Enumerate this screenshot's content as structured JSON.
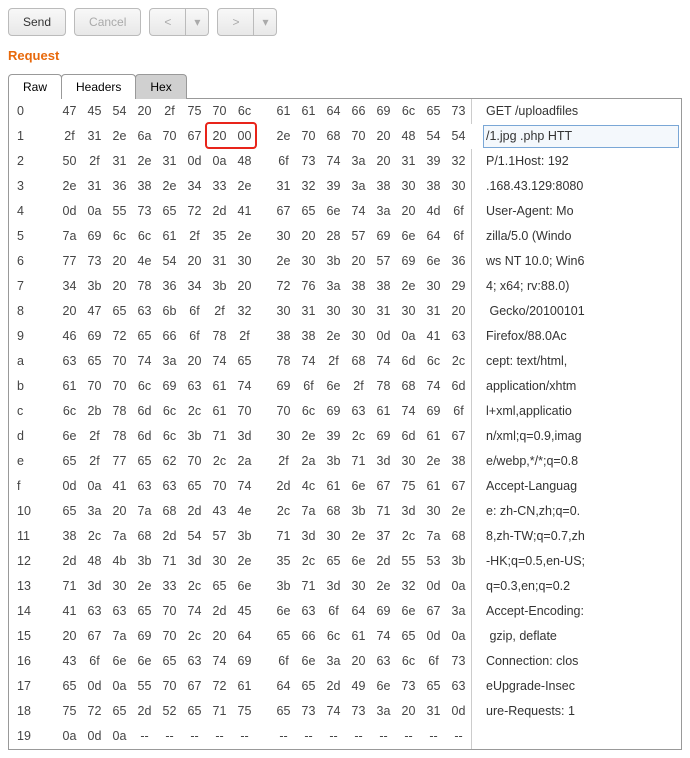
{
  "toolbar": {
    "send": "Send",
    "cancel": "Cancel",
    "back": "<",
    "forward": ">",
    "dropdown": "▾"
  },
  "section_title": "Request",
  "tabs": [
    "Raw",
    "Headers",
    "Hex"
  ],
  "active_tab": 2,
  "rows": [
    {
      "offset": "0",
      "bytes": [
        "47",
        "45",
        "54",
        "20",
        "2f",
        "75",
        "70",
        "6c",
        "61",
        "61",
        "64",
        "66",
        "69",
        "6c",
        "65",
        "73"
      ],
      "ascii": "GET /uploadfiles"
    },
    {
      "offset": "1",
      "bytes": [
        "2f",
        "31",
        "2e",
        "6a",
        "70",
        "67",
        "20",
        "00",
        "2e",
        "70",
        "68",
        "70",
        "20",
        "48",
        "54",
        "54"
      ],
      "ascii": "/1.jpg .php HTT",
      "highlighted": true
    },
    {
      "offset": "2",
      "bytes": [
        "50",
        "2f",
        "31",
        "2e",
        "31",
        "0d",
        "0a",
        "48",
        "6f",
        "73",
        "74",
        "3a",
        "20",
        "31",
        "39",
        "32"
      ],
      "ascii": "P/1.1Host: 192"
    },
    {
      "offset": "3",
      "bytes": [
        "2e",
        "31",
        "36",
        "38",
        "2e",
        "34",
        "33",
        "2e",
        "31",
        "32",
        "39",
        "3a",
        "38",
        "30",
        "38",
        "30"
      ],
      "ascii": ".168.43.129:8080"
    },
    {
      "offset": "4",
      "bytes": [
        "0d",
        "0a",
        "55",
        "73",
        "65",
        "72",
        "2d",
        "41",
        "67",
        "65",
        "6e",
        "74",
        "3a",
        "20",
        "4d",
        "6f"
      ],
      "ascii": "User-Agent: Mo"
    },
    {
      "offset": "5",
      "bytes": [
        "7a",
        "69",
        "6c",
        "6c",
        "61",
        "2f",
        "35",
        "2e",
        "30",
        "20",
        "28",
        "57",
        "69",
        "6e",
        "64",
        "6f"
      ],
      "ascii": "zilla/5.0 (Windo"
    },
    {
      "offset": "6",
      "bytes": [
        "77",
        "73",
        "20",
        "4e",
        "54",
        "20",
        "31",
        "30",
        "2e",
        "30",
        "3b",
        "20",
        "57",
        "69",
        "6e",
        "36"
      ],
      "ascii": "ws NT 10.0; Win6"
    },
    {
      "offset": "7",
      "bytes": [
        "34",
        "3b",
        "20",
        "78",
        "36",
        "34",
        "3b",
        "20",
        "72",
        "76",
        "3a",
        "38",
        "38",
        "2e",
        "30",
        "29"
      ],
      "ascii": "4; x64; rv:88.0)"
    },
    {
      "offset": "8",
      "bytes": [
        "20",
        "47",
        "65",
        "63",
        "6b",
        "6f",
        "2f",
        "32",
        "30",
        "31",
        "30",
        "30",
        "31",
        "30",
        "31",
        "20"
      ],
      "ascii": " Gecko/20100101"
    },
    {
      "offset": "9",
      "bytes": [
        "46",
        "69",
        "72",
        "65",
        "66",
        "6f",
        "78",
        "2f",
        "38",
        "38",
        "2e",
        "30",
        "0d",
        "0a",
        "41",
        "63"
      ],
      "ascii": "Firefox/88.0Ac"
    },
    {
      "offset": "a",
      "bytes": [
        "63",
        "65",
        "70",
        "74",
        "3a",
        "20",
        "74",
        "65",
        "78",
        "74",
        "2f",
        "68",
        "74",
        "6d",
        "6c",
        "2c"
      ],
      "ascii": "cept: text/html,"
    },
    {
      "offset": "b",
      "bytes": [
        "61",
        "70",
        "70",
        "6c",
        "69",
        "63",
        "61",
        "74",
        "69",
        "6f",
        "6e",
        "2f",
        "78",
        "68",
        "74",
        "6d"
      ],
      "ascii": "application/xhtm"
    },
    {
      "offset": "c",
      "bytes": [
        "6c",
        "2b",
        "78",
        "6d",
        "6c",
        "2c",
        "61",
        "70",
        "70",
        "6c",
        "69",
        "63",
        "61",
        "74",
        "69",
        "6f"
      ],
      "ascii": "l+xml,applicatio"
    },
    {
      "offset": "d",
      "bytes": [
        "6e",
        "2f",
        "78",
        "6d",
        "6c",
        "3b",
        "71",
        "3d",
        "30",
        "2e",
        "39",
        "2c",
        "69",
        "6d",
        "61",
        "67"
      ],
      "ascii": "n/xml;q=0.9,imag"
    },
    {
      "offset": "e",
      "bytes": [
        "65",
        "2f",
        "77",
        "65",
        "62",
        "70",
        "2c",
        "2a",
        "2f",
        "2a",
        "3b",
        "71",
        "3d",
        "30",
        "2e",
        "38"
      ],
      "ascii": "e/webp,*/*;q=0.8"
    },
    {
      "offset": "f",
      "bytes": [
        "0d",
        "0a",
        "41",
        "63",
        "63",
        "65",
        "70",
        "74",
        "2d",
        "4c",
        "61",
        "6e",
        "67",
        "75",
        "61",
        "67"
      ],
      "ascii": "Accept-Languag"
    },
    {
      "offset": "10",
      "bytes": [
        "65",
        "3a",
        "20",
        "7a",
        "68",
        "2d",
        "43",
        "4e",
        "2c",
        "7a",
        "68",
        "3b",
        "71",
        "3d",
        "30",
        "2e"
      ],
      "ascii": "e: zh-CN,zh;q=0."
    },
    {
      "offset": "11",
      "bytes": [
        "38",
        "2c",
        "7a",
        "68",
        "2d",
        "54",
        "57",
        "3b",
        "71",
        "3d",
        "30",
        "2e",
        "37",
        "2c",
        "7a",
        "68"
      ],
      "ascii": "8,zh-TW;q=0.7,zh"
    },
    {
      "offset": "12",
      "bytes": [
        "2d",
        "48",
        "4b",
        "3b",
        "71",
        "3d",
        "30",
        "2e",
        "35",
        "2c",
        "65",
        "6e",
        "2d",
        "55",
        "53",
        "3b"
      ],
      "ascii": "-HK;q=0.5,en-US;"
    },
    {
      "offset": "13",
      "bytes": [
        "71",
        "3d",
        "30",
        "2e",
        "33",
        "2c",
        "65",
        "6e",
        "3b",
        "71",
        "3d",
        "30",
        "2e",
        "32",
        "0d",
        "0a"
      ],
      "ascii": "q=0.3,en;q=0.2"
    },
    {
      "offset": "14",
      "bytes": [
        "41",
        "63",
        "63",
        "65",
        "70",
        "74",
        "2d",
        "45",
        "6e",
        "63",
        "6f",
        "64",
        "69",
        "6e",
        "67",
        "3a"
      ],
      "ascii": "Accept-Encoding:"
    },
    {
      "offset": "15",
      "bytes": [
        "20",
        "67",
        "7a",
        "69",
        "70",
        "2c",
        "20",
        "64",
        "65",
        "66",
        "6c",
        "61",
        "74",
        "65",
        "0d",
        "0a"
      ],
      "ascii": " gzip, deflate"
    },
    {
      "offset": "16",
      "bytes": [
        "43",
        "6f",
        "6e",
        "6e",
        "65",
        "63",
        "74",
        "69",
        "6f",
        "6e",
        "3a",
        "20",
        "63",
        "6c",
        "6f",
        "73"
      ],
      "ascii": "Connection: clos"
    },
    {
      "offset": "17",
      "bytes": [
        "65",
        "0d",
        "0a",
        "55",
        "70",
        "67",
        "72",
        "61",
        "64",
        "65",
        "2d",
        "49",
        "6e",
        "73",
        "65",
        "63"
      ],
      "ascii": "eUpgrade-Insec"
    },
    {
      "offset": "18",
      "bytes": [
        "75",
        "72",
        "65",
        "2d",
        "52",
        "65",
        "71",
        "75",
        "65",
        "73",
        "74",
        "73",
        "3a",
        "20",
        "31",
        "0d"
      ],
      "ascii": "ure-Requests: 1"
    },
    {
      "offset": "19",
      "bytes": [
        "0a",
        "0d",
        "0a",
        "",
        "",
        "",
        "",
        "",
        "",
        "",
        "",
        "",
        "",
        "",
        "",
        ""
      ],
      "ascii": "",
      "empty_fill": "--"
    }
  ],
  "highlight": {
    "row": 1,
    "start": 6,
    "end": 7
  }
}
